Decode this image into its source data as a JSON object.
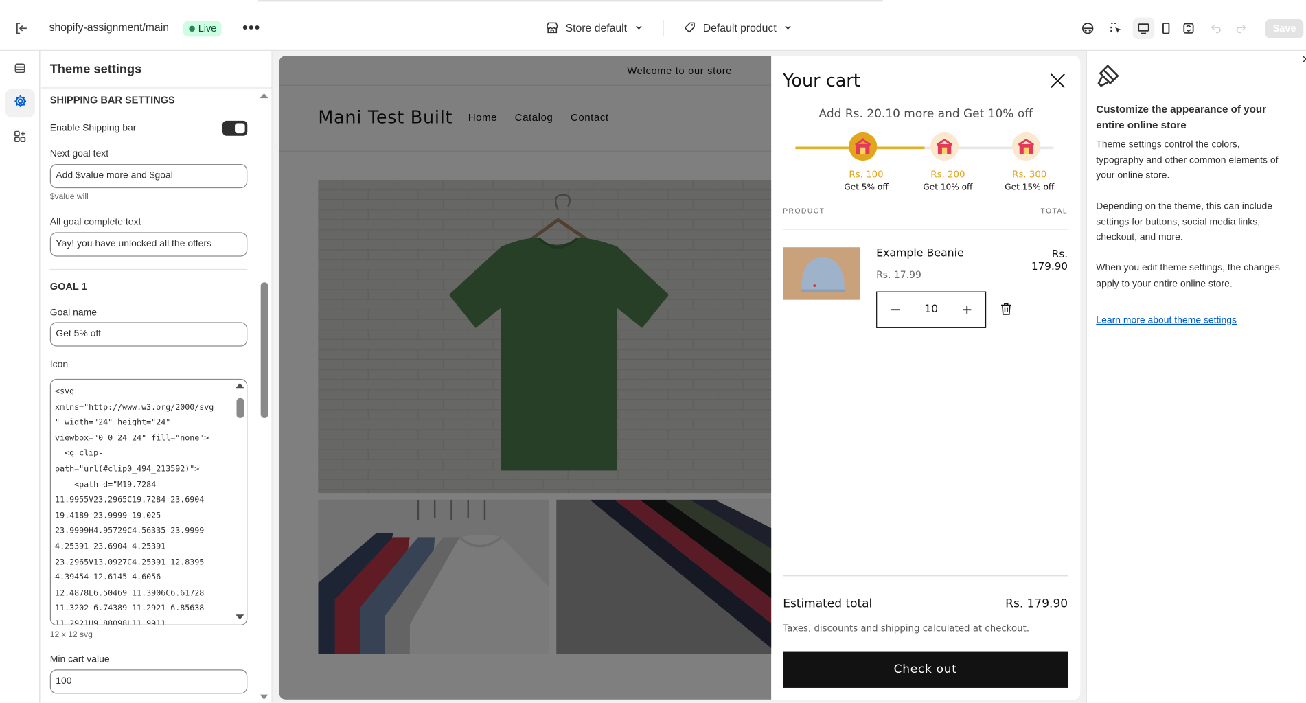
{
  "topbar": {
    "store_path": "shopify-assignment/main",
    "live_badge": "Live",
    "more_label": "•••",
    "template_select": "Store default",
    "product_select": "Default product",
    "save_label": "Save",
    "icons": [
      "exit-icon",
      "store-icon",
      "tag-icon",
      "chevron-down-icon",
      "inspector-icon",
      "select-icon",
      "desktop-icon",
      "mobile-icon",
      "fullscreen-icon",
      "undo-icon",
      "redo-icon"
    ]
  },
  "rail": {
    "items": [
      {
        "name": "sections",
        "icon": "sections-icon",
        "active": false
      },
      {
        "name": "theme-settings",
        "icon": "gear-icon",
        "active": true
      },
      {
        "name": "apps",
        "icon": "apps-icon",
        "active": false
      }
    ]
  },
  "settings": {
    "title": "Theme settings",
    "section_title": "SHIPPING BAR SETTINGS",
    "enable_label": "Enable Shipping bar",
    "enable_value": true,
    "next_goal_label": "Next goal text",
    "next_goal_value": "Add $value more and $goal",
    "next_goal_hint": "$value will",
    "complete_label": "All goal complete text",
    "complete_value": "Yay! you have unlocked all the offers",
    "goal_title": "GOAL 1",
    "goal_name_label": "Goal name",
    "goal_name_value": "Get  5% off",
    "icon_label": "Icon",
    "icon_code": "<svg\nxmlns=\"http://www.w3.org/2000/svg\n\" width=\"24\" height=\"24\"\nviewbox=\"0 0 24 24\" fill=\"none\">\n  <g clip-\npath=\"url(#clip0_494_213592)\">\n    <path d=\"M19.7284\n11.9955V23.2965C19.7284 23.6904\n19.4189 23.9999 19.025\n23.9999H4.95729C4.56335 23.9999\n4.25391 23.6904 4.25391\n23.2965V13.0927C4.25391 12.8395\n4.39454 12.6145 4.6056\n12.4878L6.50469 11.3906C6.61728\n11.3202 6.74389 11.2921 6.85638\n11.2921H9.88098L11.9911",
    "icon_hint": "12 x 12 svg",
    "min_cart_label": "Min cart value",
    "min_cart_value": "100"
  },
  "store": {
    "announcement": "Welcome to our store",
    "name": "Mani Test Built",
    "nav": [
      "Home",
      "Catalog",
      "Contact"
    ]
  },
  "cart": {
    "title": "Your cart",
    "shipping_message": "Add Rs. 20.10 more and Get 10% off",
    "progress": 0.5,
    "goals": [
      {
        "amount": "Rs. 100",
        "name": "Get 5% off",
        "reached": true
      },
      {
        "amount": "Rs. 200",
        "name": "Get 10% off",
        "reached": false
      },
      {
        "amount": "Rs. 300",
        "name": "Get 15% off",
        "reached": false
      }
    ],
    "col_product": "PRODUCT",
    "col_total": "TOTAL",
    "item": {
      "name": "Example Beanie",
      "price": "Rs. 17.99",
      "quantity": "10",
      "total_line1": "Rs.",
      "total_line2": "179.90"
    },
    "estimated_label": "Estimated total",
    "estimated_value": "Rs. 179.90",
    "tax_note": "Taxes, discounts and shipping calculated at checkout.",
    "checkout_label": "Check out",
    "colors": {
      "accent": "#e2a51d",
      "button": "#121212"
    }
  },
  "info": {
    "title": "Customize the appearance of your entire online store",
    "p1": "Theme settings control the colors, typography and other common elements of your online store.",
    "p2": "Depending on the theme, this can include settings for buttons, social media links, checkout, and more.",
    "p3": "When you edit theme settings, the changes apply to your entire online store.",
    "link": "Learn more about theme settings"
  }
}
